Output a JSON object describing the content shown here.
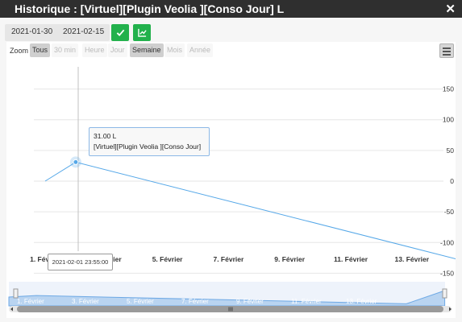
{
  "window": {
    "title": "Historique : [Virtuel][Plugin Veolia ][Conso Jour] L",
    "close_icon": "close-icon"
  },
  "date_range": {
    "start": "2021-01-30",
    "end": "2021-02-15",
    "apply_icon": "check-icon",
    "compare_icon": "chart-icon"
  },
  "zoom": {
    "label": "Zoom",
    "buttons": [
      {
        "label": "Tous",
        "active": true
      },
      {
        "label": "30 min",
        "active": false
      },
      {
        "label": "Heure",
        "active": false
      },
      {
        "label": "Jour",
        "active": false
      },
      {
        "label": "Semaine",
        "active": true
      },
      {
        "label": "Mois",
        "active": false
      },
      {
        "label": "Année",
        "active": false
      }
    ],
    "menu_icon": "hamburger-icon"
  },
  "tooltip": {
    "value": "31.00 L",
    "series": "[Virtuel][Plugin Veolia ][Conso Jour]",
    "x_label": "2021-02-01 23:55:00"
  },
  "chart_data": {
    "type": "line",
    "x_tick_labels": [
      "1. Février",
      "3. Février",
      "5. Février",
      "7. Février",
      "9. Février",
      "11. Février",
      "13. Février"
    ],
    "y_tick_labels": [
      "150",
      "100",
      "50",
      "0",
      "-50",
      "-100",
      "-150"
    ],
    "ylim": [
      -150,
      150
    ],
    "x_unit": "day of February 2021",
    "series": [
      {
        "color": "#56a8e8",
        "points": [
          [
            0.0,
            0
          ],
          [
            1.0,
            31
          ],
          [
            14.5,
            -140
          ],
          [
            15.9,
            134
          ]
        ]
      }
    ],
    "navigator_labels": [
      "1. Février",
      "3. Février",
      "5. Février",
      "7. Février",
      "9. Février",
      "11. Février",
      "13. Février"
    ]
  }
}
